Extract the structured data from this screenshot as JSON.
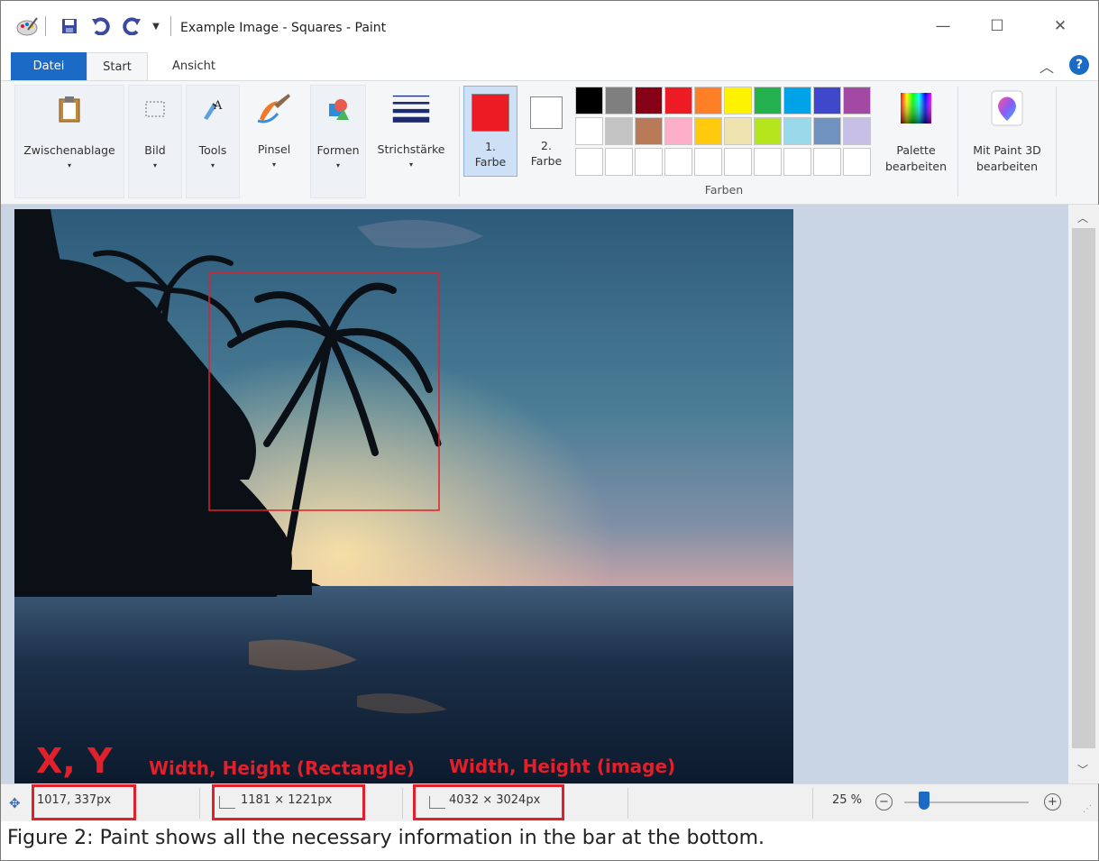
{
  "window": {
    "title": "Example Image - Squares - Paint"
  },
  "tabs": {
    "datei": "Datei",
    "start": "Start",
    "ansicht": "Ansicht"
  },
  "ribbon": {
    "zwischenablage": "Zwischenablage",
    "bild": "Bild",
    "tools": "Tools",
    "pinsel": "Pinsel",
    "formen": "Formen",
    "strichstaerke": "Strichstärke",
    "farbe1_num": "1.",
    "farbe1": "Farbe",
    "farbe2_num": "2.",
    "farbe2": "Farbe",
    "palette_l1": "Palette",
    "palette_l2": "bearbeiten",
    "paint3d_l1": "Mit Paint 3D",
    "paint3d_l2": "bearbeiten",
    "farben_group": "Farben",
    "dropdown_glyph": "▾"
  },
  "colors": {
    "color1": "#ed1c24",
    "color2": "#ffffff",
    "palette_row1": [
      "#000000",
      "#7f7f7f",
      "#880015",
      "#ed1c24",
      "#ff7f27",
      "#fff200",
      "#22b14c",
      "#00a2e8",
      "#3f48cc",
      "#a349a4"
    ],
    "palette_row2": [
      "#ffffff",
      "#c3c3c3",
      "#b97a57",
      "#ffaec9",
      "#ffc90e",
      "#efe4b0",
      "#b5e61d",
      "#99d9ea",
      "#7092be",
      "#c8bfe7"
    ],
    "palette_row3": [
      "#ffffff",
      "#ffffff",
      "#ffffff",
      "#ffffff",
      "#ffffff",
      "#ffffff",
      "#ffffff",
      "#ffffff",
      "#ffffff",
      "#ffffff"
    ],
    "accent_red": "#e0202a"
  },
  "status": {
    "cursor_pos": "1017, 337px",
    "selection_size": "1181 × 1221px",
    "image_size": "4032 × 3024px",
    "zoom": "25 %"
  },
  "annotations": {
    "xy": "X, Y",
    "rect": "Width, Height (Rectangle)",
    "image": "Width, Height (image)"
  },
  "caption": "Figure 2: Paint shows all the necessary information in the bar at the bottom."
}
